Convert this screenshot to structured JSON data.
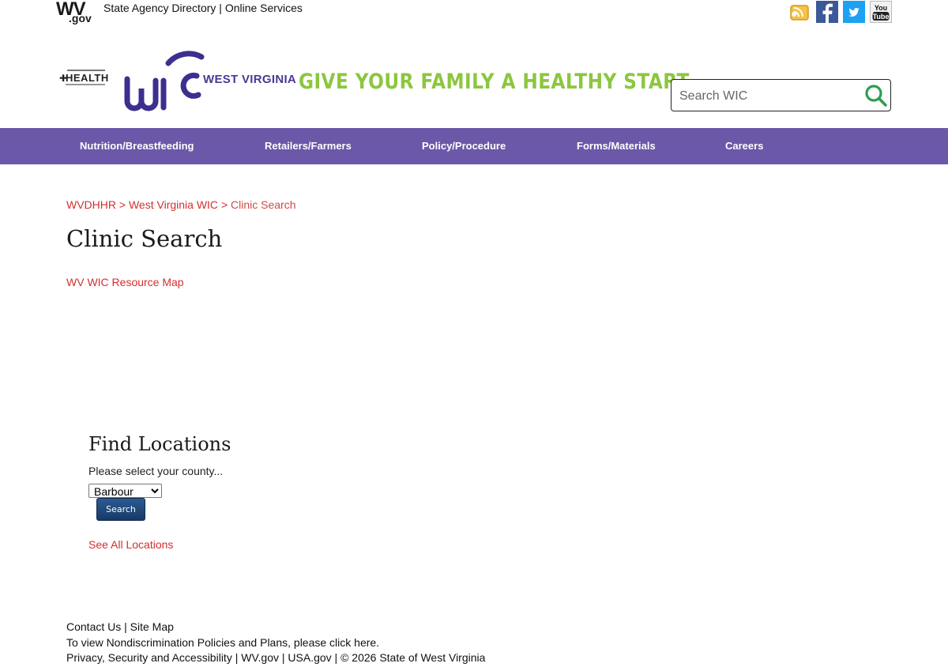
{
  "topbar": {
    "logo_text": "WV",
    "logo_sub": ".gov",
    "state_agency_directory": "State Agency Directory",
    "separator": "|",
    "online_services": "Online Services",
    "social": [
      "rss-icon",
      "facebook-icon",
      "twitter-icon",
      "youtube-icon"
    ]
  },
  "header": {
    "health_logo_text": "HEALTH",
    "wic_state": "WEST VIRGINIA",
    "tagline": "GIVE YOUR FAMILY A HEALTHY START",
    "search_placeholder": "Search WIC"
  },
  "nav": [
    {
      "label": "Nutrition/Breastfeeding"
    },
    {
      "label": "Retailers/Farmers"
    },
    {
      "label": "Policy/Procedure"
    },
    {
      "label": "Forms/Materials"
    },
    {
      "label": "Careers"
    }
  ],
  "breadcrumb": {
    "items": [
      "WVDHHR",
      "West Virginia WIC"
    ],
    "separator": ">",
    "current": "Clinic Search"
  },
  "page": {
    "title": "Clinic Search",
    "resource_map_link": "WV WIC Resource Map"
  },
  "locator": {
    "title": "Find Locations",
    "county_label": "Please select your county...",
    "county_selected": "Barbour",
    "search_button": "Search",
    "see_all": "See All Locations"
  },
  "footer": {
    "contact": "Contact Us",
    "site_map": "Site Map",
    "sep": "|",
    "nondiscrimination": "To view Nondiscrimination Policies and Plans, please click here.",
    "privacy": "Privacy, Security and Accessibility",
    "wvgov": "WV.gov",
    "usagov": "USA.gov",
    "copyright": "© 2026 State of West Virginia"
  },
  "colors": {
    "nav_bg": "#6b58a8",
    "link_red": "#d32f2f",
    "tagline_green": "#8cc63f",
    "wic_purple": "#4a3a95",
    "search_icon_green": "#2e9e4f",
    "button_blue": "#1f4a7d"
  }
}
